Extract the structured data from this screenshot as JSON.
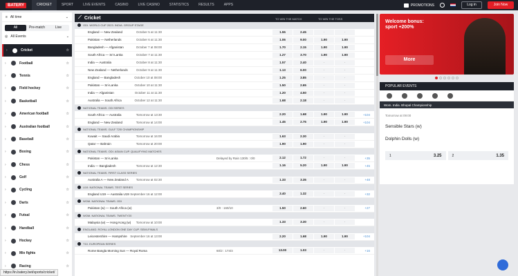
{
  "header": {
    "logo": "BATERY",
    "nav": [
      "CRICKET",
      "SPORT",
      "LIVE EVENTS",
      "CASINO",
      "LIVE CASINO",
      "STATISTICS",
      "RESULTS",
      "APPS"
    ],
    "promotions": "PROMOTIONS",
    "login": "Log in",
    "join": "Join Now"
  },
  "left": {
    "time_filter": "All time",
    "tabs": [
      "All",
      "Pre-match",
      "Live"
    ],
    "events_filter": "All Events",
    "sports": [
      "Cricket",
      "Football",
      "Tennis",
      "Field hockey",
      "Basketball",
      "American football",
      "Australian football",
      "Baseball",
      "Boxing",
      "Chess",
      "Golf",
      "Cycling",
      "Darts",
      "Futsal",
      "Handball",
      "Hockey",
      "Mix fights",
      "Racing"
    ]
  },
  "main": {
    "title": "Cricket",
    "col_match": "TO WIN THE MATCH",
    "col_toss": "TO WIN THE TOSS",
    "col1": "1",
    "col2": "2",
    "col3": "1",
    "col4": "2"
  },
  "rows": [
    {
      "type": "section",
      "label": "ODI. WORLD CUP 2023. INDIA. GROUP STAGE"
    },
    {
      "type": "match",
      "teams": "England — New Zealand",
      "time": "October 5 at 11:30",
      "o": [
        "1.55",
        "2.45",
        "-",
        "-"
      ],
      "more": ""
    },
    {
      "type": "match",
      "teams": "Pakistan — Netherlands",
      "time": "October 6 at 11:30",
      "o": [
        "1.06",
        "9.00",
        "1.90",
        "1.90"
      ],
      "more": ""
    },
    {
      "type": "match",
      "teams": "Bangladesh — Afganistan",
      "time": "October 7 at 08:00",
      "o": [
        "1.70",
        "2.15",
        "1.90",
        "1.90"
      ],
      "more": ""
    },
    {
      "type": "match",
      "teams": "South Africa — Sri-Lanka",
      "time": "October 7 at 11:30",
      "o": [
        "1.27",
        "3.70",
        "1.90",
        "1.90"
      ],
      "more": ""
    },
    {
      "type": "match",
      "teams": "India — Australia",
      "time": "October 8 at 11:30",
      "o": [
        "1.57",
        "2.40",
        "-",
        "-"
      ],
      "more": ""
    },
    {
      "type": "match",
      "teams": "New Zealand — Netherlands",
      "time": "October 9 at 11:30",
      "o": [
        "1.13",
        "6.00",
        "-",
        "-"
      ],
      "more": ""
    },
    {
      "type": "match",
      "teams": "England — Bangladesh",
      "time": "October 10 at 08:00",
      "o": [
        "1.25",
        "3.85",
        "-",
        "-"
      ],
      "more": ""
    },
    {
      "type": "match",
      "teams": "Pakistan — Sri-Lanka",
      "time": "October 10 at 11:30",
      "o": [
        "1.50",
        "2.65",
        "-",
        "-"
      ],
      "more": ""
    },
    {
      "type": "match",
      "teams": "India — Afganistan",
      "time": "October 11 at 11:30",
      "o": [
        "1.20",
        "4.50",
        "-",
        "-"
      ],
      "more": ""
    },
    {
      "type": "match",
      "teams": "Australia — South Africa",
      "time": "October 12 at 11:30",
      "o": [
        "1.68",
        "2.18",
        "-",
        "-"
      ],
      "more": ""
    },
    {
      "type": "section",
      "label": "NATIONAL TEAMS. ODI SERIES"
    },
    {
      "type": "match",
      "teams": "South Africa — Australia",
      "time": "Tomorrow at 13:30",
      "o": [
        "2.20",
        "1.68",
        "1.90",
        "1.90"
      ],
      "more": "+104"
    },
    {
      "type": "match",
      "teams": "England — New Zealand",
      "time": "Tomorrow at 14:00",
      "o": [
        "1.45",
        "2.75",
        "1.90",
        "1.90"
      ],
      "more": "+104"
    },
    {
      "type": "section",
      "label": "NATIONAL TEAMS. GULF T20I CHAMPIONSHIP"
    },
    {
      "type": "match",
      "teams": "Kuwait — Saudi Arabia",
      "time": "Tomorrow at 16:00",
      "o": [
        "1.63",
        "2.30",
        "-",
        "-"
      ],
      "more": ""
    },
    {
      "type": "match",
      "teams": "Qatar — Bahrain",
      "time": "Tomorrow at 20:00",
      "o": [
        "1.90",
        "1.90",
        "-",
        "-"
      ],
      "more": ""
    },
    {
      "type": "section",
      "label": "NATIONAL TEAMS. ODI. ASIAN CUP. QUALIFYING MATCHES"
    },
    {
      "type": "match",
      "teams": "Pakistan — Sri-Lanka",
      "time": "",
      "info": "Delayed by Rain 130/5 : 0/0",
      "o": [
        "2.12",
        "1.72",
        "-",
        "-"
      ],
      "more": "+35"
    },
    {
      "type": "match",
      "teams": "India — Bangladesh",
      "time": "Tomorrow at 12:30",
      "o": [
        "1.16",
        "5.20",
        "1.90",
        "1.90"
      ],
      "more": "+45"
    },
    {
      "type": "section",
      "label": "NATIONAL TEAMS. FIRST CLASS SERIES"
    },
    {
      "type": "match",
      "teams": "Australia A — New Zealand A",
      "time": "Tomorrow at 02:30",
      "o": [
        "1.33",
        "3.35",
        "-",
        "-"
      ],
      "more": "+48"
    },
    {
      "type": "section",
      "label": "U19. NATIONAL TEAMS. TEST SERIES"
    },
    {
      "type": "match",
      "teams": "England U19 — Australia U19",
      "time": "September 16 at 12:00",
      "o": [
        "3.40",
        "1.32",
        "-",
        "-"
      ],
      "more": "+32"
    },
    {
      "type": "section",
      "label": "WOM. NATIONAL TEAMS. ODI"
    },
    {
      "type": "match",
      "teams": "Pakistan (w) — South Africa (w)",
      "time": "",
      "info": "3/0 : 169/10",
      "o": [
        "1.50",
        "2.60",
        "-",
        "-"
      ],
      "more": "+27"
    },
    {
      "type": "section",
      "label": "WOM. NATIONAL TEAMS. TWENTY20"
    },
    {
      "type": "match",
      "teams": "Malaysia (w) — Hong Kong (w)",
      "time": "Tomorrow at 10:00",
      "o": [
        "1.33",
        "3.30",
        "-",
        "-"
      ],
      "more": ""
    },
    {
      "type": "section",
      "label": "ENGLAND. ROYAL LONDON ONE DAY CUP. SEMI-FINALS"
    },
    {
      "type": "match",
      "teams": "Leicestershire — Hampshire",
      "time": "September 16 at 13:00",
      "o": [
        "2.20",
        "1.68",
        "1.90",
        "1.90"
      ],
      "more": "+104"
    },
    {
      "type": "section",
      "label": "T10. EUROPEAN SERIES"
    },
    {
      "type": "match",
      "teams": "Rome Bangla Morning Sun — Royal Roma",
      "time": "",
      "info": "60/2 : 174/4",
      "o": [
        "13.00",
        "1.03",
        "-",
        "-"
      ],
      "more": "+16"
    }
  ],
  "banner": {
    "text": "Welcome bonus: sport +200%",
    "button": "More"
  },
  "popular": {
    "title": "POPULAR EVENTS",
    "league": "Wom. India. Bhopal Championship",
    "date": "Tomorrow at 09:00",
    "team1": "Sensible Stars (w)",
    "team2": "Dolphin Dolls (w)",
    "o1_label": "1",
    "o1": "3.25",
    "o2_label": "2",
    "o2": "1.35"
  },
  "status_url": "https://in.batery.bet/sports/cricket/"
}
